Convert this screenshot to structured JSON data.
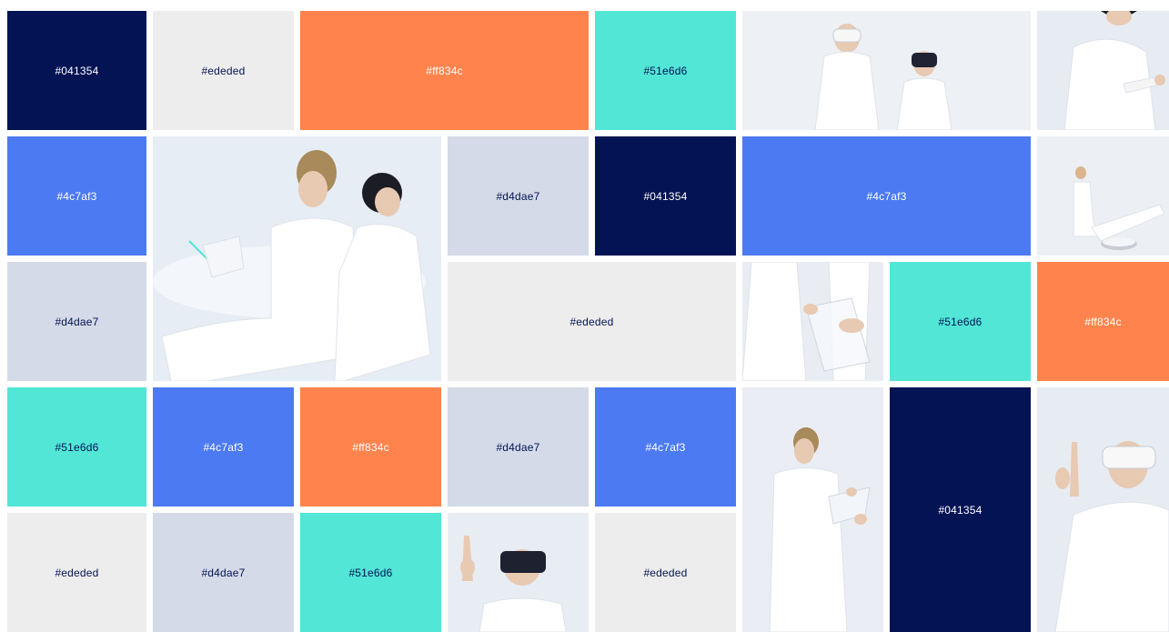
{
  "swatches": {
    "r1c1": "#041354",
    "r1c2": "#ededed",
    "r1c3": "#ff834c",
    "r1c5": "#51e6d6",
    "r2c1": "#4c7af3",
    "r2c4": "#d4dae7",
    "r2c5": "#041354",
    "r2c6": "#4c7af3",
    "r3c1": "#d4dae7",
    "r3c4": "#ededed",
    "r3c7": "#51e6d6",
    "r3c8": "#ff834c",
    "r4c1": "#51e6d6",
    "r4c2": "#4c7af3",
    "r4c3": "#ff834c",
    "r4c4": "#d4dae7",
    "r4c5": "#4c7af3",
    "r4c7": "#041354",
    "r5c1": "#ededed",
    "r5c2": "#d4dae7",
    "r5c3": "#51e6d6",
    "r5c5": "#ededed"
  },
  "palette": {
    "navy": "#041354",
    "light_gray": "#ededed",
    "orange": "#ff834c",
    "teal": "#51e6d6",
    "blue": "#4c7af3",
    "lilac": "#d4dae7"
  }
}
